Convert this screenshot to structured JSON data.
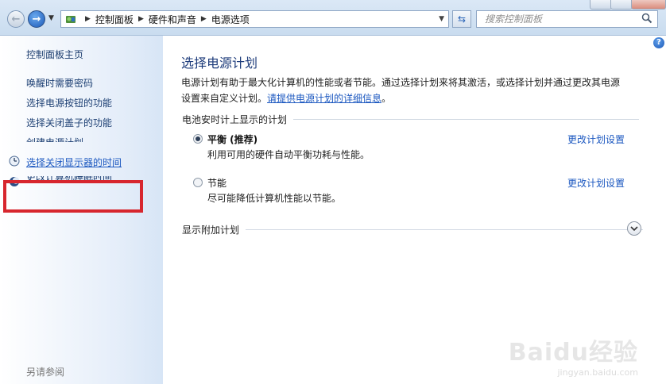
{
  "address_bar": {
    "breadcrumbs": [
      "控制面板",
      "硬件和声音",
      "电源选项"
    ],
    "search_placeholder": "搜索控制面板"
  },
  "sidebar": {
    "home": "控制面板主页",
    "items": [
      {
        "label": "唤醒时需要密码"
      },
      {
        "label": "选择电源按钮的功能"
      },
      {
        "label": "选择关闭盖子的功能"
      },
      {
        "label": "创建电源计划"
      },
      {
        "label": "选择关闭显示器的时间",
        "highlighted": true
      },
      {
        "label": "更改计算机睡眠时间"
      }
    ],
    "see_also": "另请参阅",
    "highlight_color": "#d7262e"
  },
  "main": {
    "title": "选择电源计划",
    "description_text": "电源计划有助于最大化计算机的性能或者节能。通过选择计划来将其激活，或选择计划并通过更改其电源设置来自定义计划。",
    "description_link": "请提供电源计划的详细信息",
    "description_end": "。",
    "section_label": "电池安时计上显示的计划",
    "plans": [
      {
        "name": "平衡 (推荐)",
        "description": "利用可用的硬件自动平衡功耗与性能。",
        "selected": true,
        "change_link": "更改计划设置"
      },
      {
        "name": "节能",
        "description": "尽可能降低计算机性能以节能。",
        "selected": false,
        "change_link": "更改计划设置"
      }
    ],
    "more_plans": "显示附加计划"
  },
  "watermark": {
    "main": "Baidu经验",
    "sub": "jingyan.baidu.com"
  },
  "colors": {
    "link": "#1c58c0",
    "title": "#1e3c7b",
    "sidebar_bg": "#d7e5f6"
  }
}
